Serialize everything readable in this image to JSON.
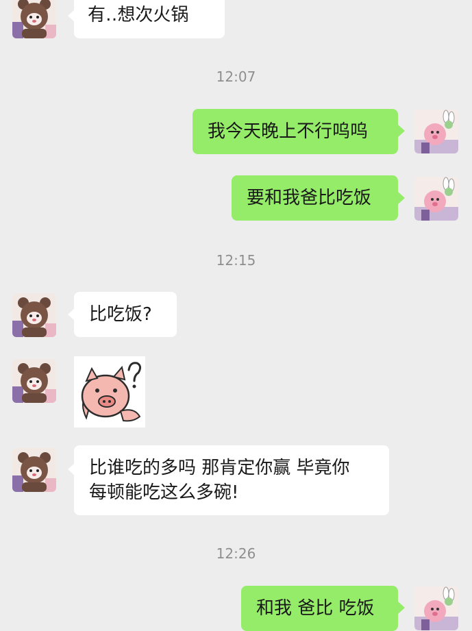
{
  "avatars": {
    "friend": "bear-avatar",
    "me": "bunny-avatar"
  },
  "colors": {
    "background": "#ededed",
    "incoming_bubble": "#ffffff",
    "outgoing_bubble": "#95ec69",
    "timestamp": "#8e8e8e"
  },
  "messages": [
    {
      "side": "in",
      "text": "有‥想次火锅"
    },
    {
      "timestamp": "12:07"
    },
    {
      "side": "out",
      "text": "我今天晚上不行呜呜"
    },
    {
      "side": "out",
      "text": "要和我爸比吃饭"
    },
    {
      "timestamp": "12:15"
    },
    {
      "side": "in",
      "text": "比吃饭?"
    },
    {
      "side": "in",
      "sticker": "pig-question-sticker"
    },
    {
      "side": "in",
      "text_lines": [
        "比谁吃的多吗 那肯定你赢 毕竟你",
        "每顿能吃这么多碗!"
      ]
    },
    {
      "timestamp": "12:26"
    },
    {
      "side": "out",
      "text": "和我 爸比 吃饭"
    }
  ]
}
